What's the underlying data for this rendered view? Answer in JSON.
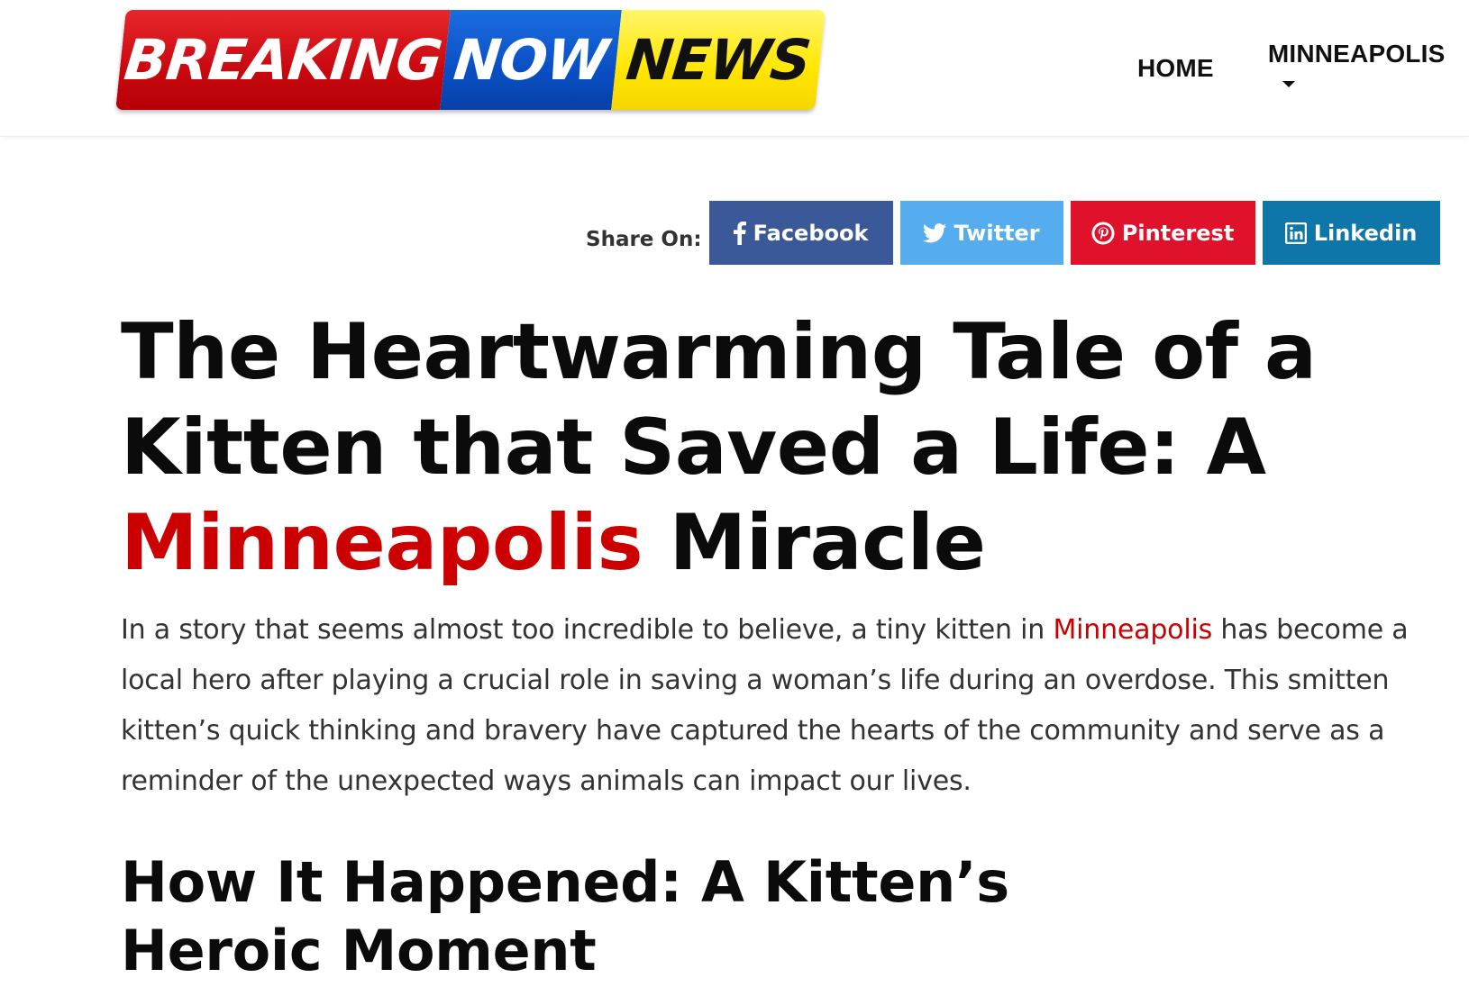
{
  "header": {
    "logo": {
      "word1": "BREAKING",
      "word2": "NOW",
      "word3": "NEWS"
    },
    "nav": {
      "home": "HOME",
      "minneapolis": "MINNEAPOLIS"
    }
  },
  "share": {
    "label": "Share On:",
    "facebook": "Facebook",
    "twitter": "Twitter",
    "pinterest": "Pinterest",
    "linkedin": "Linkedin"
  },
  "article": {
    "title_part1": "The Heartwarming Tale of a Kitten that Saved a Life: A ",
    "title_highlight": "Minneapolis",
    "title_part2": " Miracle",
    "lead_part1": "In a story that seems almost too incredible to believe, a tiny kitten in ",
    "lead_highlight": "Minneapolis",
    "lead_part2": " has become a local hero after playing a crucial role in saving a woman’s life during an overdose. This smitten kitten’s quick thinking and bravery have captured the hearts of the community and serve as a reminder of the unexpected ways animals can impact our lives.",
    "subheading": "How It Happened: A Kitten’s Heroic Moment"
  },
  "colors": {
    "accent_red": "#cc0000",
    "facebook": "#3b5998",
    "twitter": "#55acee",
    "pinterest": "#e0112b",
    "linkedin": "#0e76a8"
  }
}
